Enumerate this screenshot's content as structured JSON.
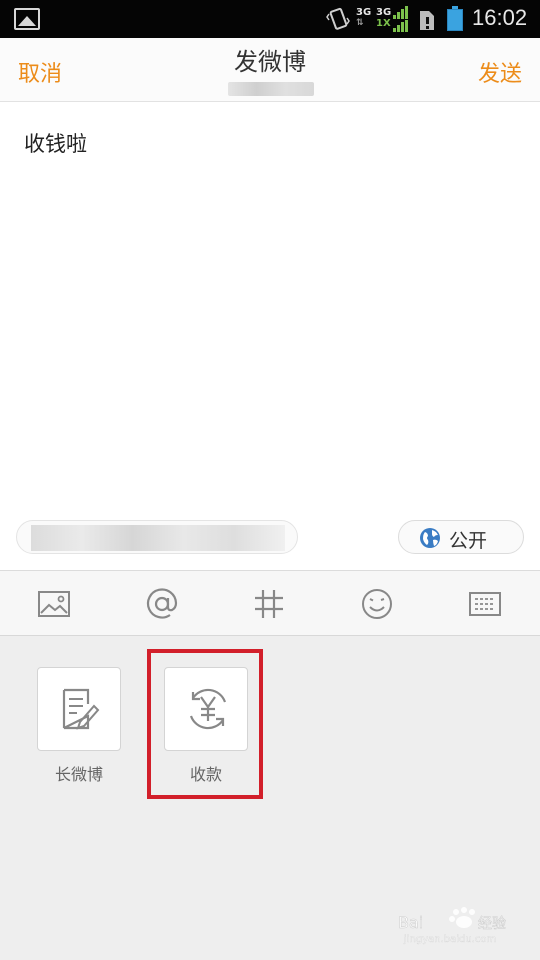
{
  "status_bar": {
    "network1": "3G",
    "network2_top": "3G",
    "network2_bottom": "1X",
    "time": "16:02"
  },
  "header": {
    "cancel_label": "取消",
    "title": "发微博",
    "send_label": "发送"
  },
  "compose": {
    "text": "收钱啦",
    "visibility_label": "公开"
  },
  "toolbar": {
    "icons": [
      "image-icon",
      "at-icon",
      "hashtag-icon",
      "emoji-icon",
      "keyboard-icon"
    ]
  },
  "panel": {
    "tiles": [
      {
        "label": "长微博",
        "icon": "long-post-icon"
      },
      {
        "label": "收款",
        "icon": "payment-icon"
      }
    ]
  },
  "colors": {
    "accent": "#ec8c1a",
    "highlight": "#d21f2a",
    "status_bar": "#050505"
  }
}
